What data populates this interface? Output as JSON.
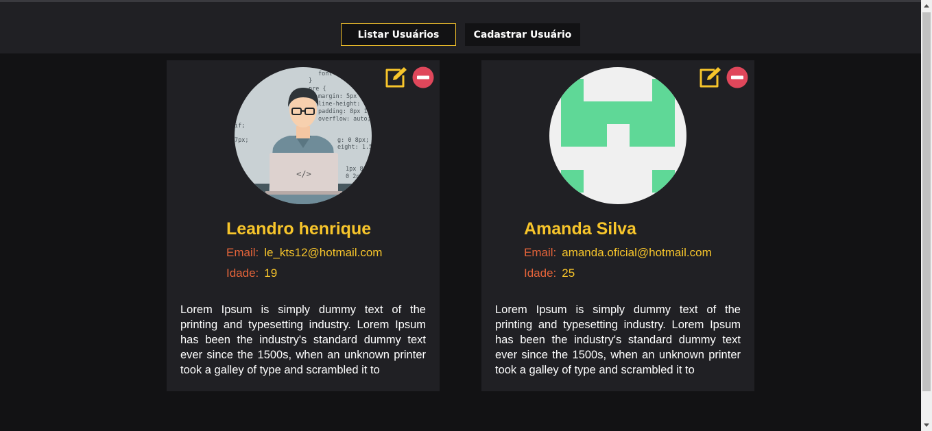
{
  "nav": {
    "tabs": [
      {
        "label": "Listar Usuários"
      },
      {
        "label": "Cadastrar Usuário"
      }
    ]
  },
  "colors": {
    "background": "#121214",
    "card": "#202024",
    "accent": "#f7c52b",
    "label": "#e5643a",
    "remove": "#e0475b",
    "avatar2_green": "#5fd897",
    "avatar2_bg": "#f0f0f0"
  },
  "labels": {
    "email": "Email:",
    "age": "Idade:"
  },
  "users": [
    {
      "name": "Leandro henrique",
      "email": "le_kts12@hotmail.com",
      "age": "19",
      "description": "Lorem Ipsum is simply dummy text of the printing and typesetting industry. Lorem Ipsum has been the industry's standard dummy text ever since the 1500s, when an unknown printer took a galley of type and scrambled it to",
      "avatar_code_text": [
        "font",
        "}",
        "pre {",
        "margin: 5px",
        "line-height: 1.",
        "padding: 8px 1",
        "overflow: auto;",
        "if;",
        "7px;",
        "g: 0 8px;",
        "eight: 1.5;",
        "1px 8",
        "0 2p",
        "</>"
      ]
    },
    {
      "name": "Amanda Silva",
      "email": "amanda.oficial@hotmail.com",
      "age": "25",
      "description": "Lorem Ipsum is simply dummy text of the printing and typesetting industry. Lorem Ipsum has been the industry's standard dummy text ever since the 1500s, when an unknown printer took a galley of type and scrambled it to"
    }
  ],
  "icons": {
    "edit": "edit-icon",
    "remove": "remove-icon",
    "scroll_up": "chevron-up-icon",
    "scroll_down": "chevron-down-icon"
  }
}
